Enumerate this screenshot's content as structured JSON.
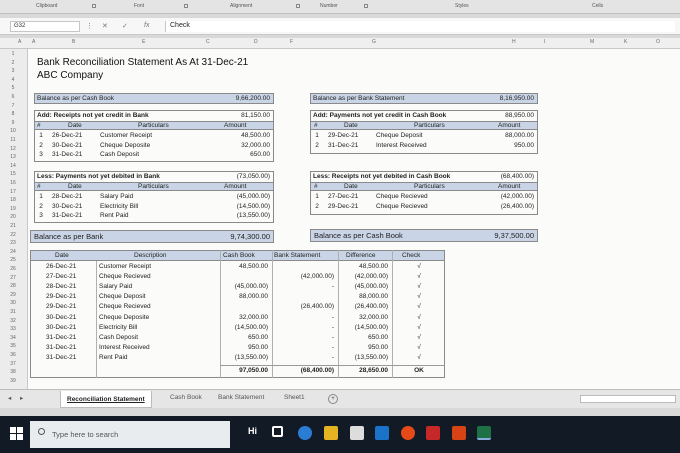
{
  "ribbon": {
    "groups": [
      "Clipboard",
      "Font",
      "Alignment",
      "Number",
      "Styles",
      "Cells"
    ]
  },
  "formula_bar": {
    "name_box": "G32",
    "formula": "Check"
  },
  "columns": [
    "A",
    "A",
    "B",
    "E",
    "C",
    "D",
    "F",
    "G",
    "H",
    "I",
    "M",
    "K",
    "O"
  ],
  "rows": [
    "1",
    "2",
    "3",
    "4",
    "5",
    "6",
    "7",
    "8",
    "9",
    "10",
    "11",
    "12",
    "13",
    "14",
    "15",
    "16",
    "17",
    "18",
    "19",
    "20",
    "21",
    "22",
    "23",
    "24",
    "25",
    "26",
    "27",
    "28",
    "29",
    "30",
    "31",
    "32",
    "33",
    "34",
    "35",
    "36",
    "37",
    "38",
    "39"
  ],
  "statement": {
    "title": "Bank Reconciliation Statement As At",
    "date": "31-Dec-21",
    "company": "ABC Company"
  },
  "left_block": {
    "opening_label": "Balance as per Cash Book",
    "opening_value": "9,66,200.00",
    "add_label": "Add: Receipts not yet credit in Bank",
    "add_total": "81,150.00",
    "headers": [
      "#",
      "Date",
      "Particulars",
      "Amount"
    ],
    "add_rows": [
      {
        "n": "1",
        "date": "26-Dec-21",
        "part": "Customer Receipt",
        "amt": "48,500.00"
      },
      {
        "n": "2",
        "date": "30-Dec-21",
        "part": "Cheque Deposite",
        "amt": "32,000.00"
      },
      {
        "n": "3",
        "date": "31-Dec-21",
        "part": "Cash Deposit",
        "amt": "650.00"
      }
    ],
    "less_label": "Less: Payments not yet debited in Bank",
    "less_total": "(73,050.00)",
    "less_rows": [
      {
        "n": "1",
        "date": "28-Dec-21",
        "part": "Salary Paid",
        "amt": "(45,000.00)"
      },
      {
        "n": "2",
        "date": "30-Dec-21",
        "part": "Electricity Bill",
        "amt": "(14,500.00)"
      },
      {
        "n": "3",
        "date": "31-Dec-21",
        "part": "Rent Paid",
        "amt": "(13,550.00)"
      }
    ],
    "closing_label": "Balance as per Bank",
    "closing_value": "9,74,300.00"
  },
  "right_block": {
    "opening_label": "Balance as per Bank Statement",
    "opening_value": "8,16,950.00",
    "add_label": "Add: Payments not yet credit in Cash Book",
    "add_total": "88,950.00",
    "headers": [
      "#",
      "Date",
      "Particulars",
      "Amount"
    ],
    "add_rows": [
      {
        "n": "1",
        "date": "29-Dec-21",
        "part": "Cheque Deposit",
        "amt": "88,000.00"
      },
      {
        "n": "2",
        "date": "31-Dec-21",
        "part": "Interest Received",
        "amt": "950.00"
      }
    ],
    "less_label": "Less: Receipts not yet debited in Cash Book",
    "less_total": "(68,400.00)",
    "less_rows": [
      {
        "n": "1",
        "date": "27-Dec-21",
        "part": "Cheque Recieved",
        "amt": "(42,000.00)"
      },
      {
        "n": "2",
        "date": "29-Dec-21",
        "part": "Cheque Recieved",
        "amt": "(26,400.00)"
      }
    ],
    "closing_label": "Balance as per Cash Book",
    "closing_value": "9,37,500.00"
  },
  "check_table": {
    "headers": [
      "Date",
      "Description",
      "Cash Book",
      "Bank Statement",
      "Difference",
      "Check"
    ],
    "rows": [
      {
        "date": "26-Dec-21",
        "desc": "Customer Receipt",
        "cash": "48,500.00",
        "bank": "",
        "diff": "48,500.00",
        "check": "√"
      },
      {
        "date": "27-Dec-21",
        "desc": "Cheque Recieved",
        "cash": "",
        "bank": "(42,000.00)",
        "diff": "(42,000.00)",
        "check": "√"
      },
      {
        "date": "28-Dec-21",
        "desc": "Salary Paid",
        "cash": "(45,000.00)",
        "bank": "-",
        "diff": "(45,000.00)",
        "check": "√"
      },
      {
        "date": "29-Dec-21",
        "desc": "Cheque Deposit",
        "cash": "88,000.00",
        "bank": "",
        "diff": "88,000.00",
        "check": "√"
      },
      {
        "date": "29-Dec-21",
        "desc": "Cheque Recieved",
        "cash": "",
        "bank": "(26,400.00)",
        "diff": "(26,400.00)",
        "check": "√"
      },
      {
        "date": "30-Dec-21",
        "desc": "Cheque Deposite",
        "cash": "32,000.00",
        "bank": "-",
        "diff": "32,000.00",
        "check": "√"
      },
      {
        "date": "30-Dec-21",
        "desc": "Electricity Bill",
        "cash": "(14,500.00)",
        "bank": "-",
        "diff": "(14,500.00)",
        "check": "√"
      },
      {
        "date": "31-Dec-21",
        "desc": "Cash Deposit",
        "cash": "650.00",
        "bank": "-",
        "diff": "650.00",
        "check": "√"
      },
      {
        "date": "31-Dec-21",
        "desc": "Interest Received",
        "cash": "950.00",
        "bank": "-",
        "diff": "950.00",
        "check": "√"
      },
      {
        "date": "31-Dec-21",
        "desc": "Rent Paid",
        "cash": "(13,550.00)",
        "bank": "-",
        "diff": "(13,550.00)",
        "check": "√"
      }
    ],
    "total": {
      "cash": "97,050.00",
      "bank": "(68,400.00)",
      "diff": "28,650.00",
      "check": "OK"
    }
  },
  "sheet_tabs": [
    "Reconciliation Statement",
    "Cash Book",
    "Bank Statement",
    "Sheet1"
  ],
  "taskbar": {
    "search_placeholder": "Type here to search"
  },
  "colors": {
    "header_fill": "#c9d5e6",
    "taskbar": "#121b25"
  }
}
